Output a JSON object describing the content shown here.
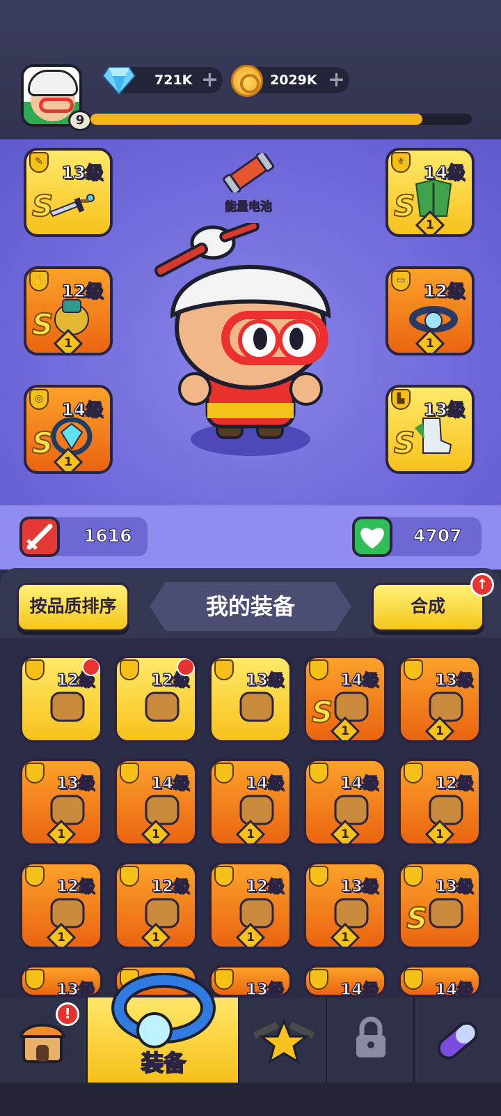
{
  "player": {
    "level": "9",
    "xp_progress": 0.87
  },
  "currencies": {
    "gems": {
      "amount": "721K",
      "icon": "diamond-icon"
    },
    "coins": {
      "amount": "2029K",
      "icon": "coin-icon"
    }
  },
  "hero": {
    "battery_label": "能量电池",
    "attack_value": "1616",
    "health_value": "4707"
  },
  "equipped": {
    "weapon": {
      "level": "13级",
      "grade": "S",
      "count": ""
    },
    "armor": {
      "level": "14级",
      "grade": "S",
      "count": "1"
    },
    "gloves": {
      "level": "12级",
      "grade": "S",
      "count": "1"
    },
    "belt": {
      "level": "12级",
      "grade": "",
      "count": "1"
    },
    "ring": {
      "level": "14级",
      "grade": "S",
      "count": "1"
    },
    "boots": {
      "level": "13级",
      "grade": "S",
      "count": ""
    }
  },
  "inventory": {
    "sort_button": "按品质排序",
    "title": "我的装备",
    "merge_button": "合成",
    "items": [
      {
        "level": "12级",
        "grade": "",
        "count": "",
        "icon": "gloves-icon"
      },
      {
        "level": "12级",
        "grade": "",
        "count": "",
        "icon": "gloves-icon"
      },
      {
        "level": "13级",
        "grade": "",
        "count": "",
        "icon": "boots-icon"
      },
      {
        "level": "14级",
        "grade": "S",
        "count": "1",
        "icon": "armor-icon"
      },
      {
        "level": "13级",
        "grade": "",
        "count": "1",
        "icon": "knife-icon"
      },
      {
        "level": "13级",
        "grade": "",
        "count": "1",
        "icon": "wand-icon"
      },
      {
        "level": "14级",
        "grade": "",
        "count": "1",
        "icon": "cloak-icon"
      },
      {
        "level": "14级",
        "grade": "",
        "count": "1",
        "icon": "ring-icon"
      },
      {
        "level": "14级",
        "grade": "",
        "count": "1",
        "icon": "ring-icon"
      },
      {
        "level": "12级",
        "grade": "",
        "count": "1",
        "icon": "belt-icon"
      },
      {
        "level": "12级",
        "grade": "",
        "count": "1",
        "icon": "belt-icon"
      },
      {
        "level": "12级",
        "grade": "",
        "count": "1",
        "icon": "belt-icon"
      },
      {
        "level": "12级",
        "grade": "",
        "count": "1",
        "icon": "belt-icon"
      },
      {
        "level": "13级",
        "grade": "",
        "count": "1",
        "icon": "boots-icon"
      },
      {
        "level": "13级",
        "grade": "S",
        "count": "",
        "icon": "boots-icon"
      },
      {
        "level": "13级",
        "grade": "",
        "count": "",
        "icon": "knife-icon"
      },
      {
        "level": "",
        "grade": "",
        "count": "",
        "icon": "cloak-icon"
      },
      {
        "level": "13级",
        "grade": "",
        "count": "",
        "icon": "knife-icon"
      },
      {
        "level": "14级",
        "grade": "",
        "count": "",
        "icon": "armor-icon"
      },
      {
        "level": "14级",
        "grade": "",
        "count": "",
        "icon": "ring-icon"
      }
    ]
  },
  "nav": {
    "shop_badge": "!",
    "equipment_label": "装备",
    "tabs": [
      "shop",
      "equipment",
      "talent",
      "locked",
      "capsule"
    ]
  },
  "colors": {
    "gold": "#f7c21c",
    "orange": "#ea6410",
    "panel_purple": "#6b65d8"
  }
}
